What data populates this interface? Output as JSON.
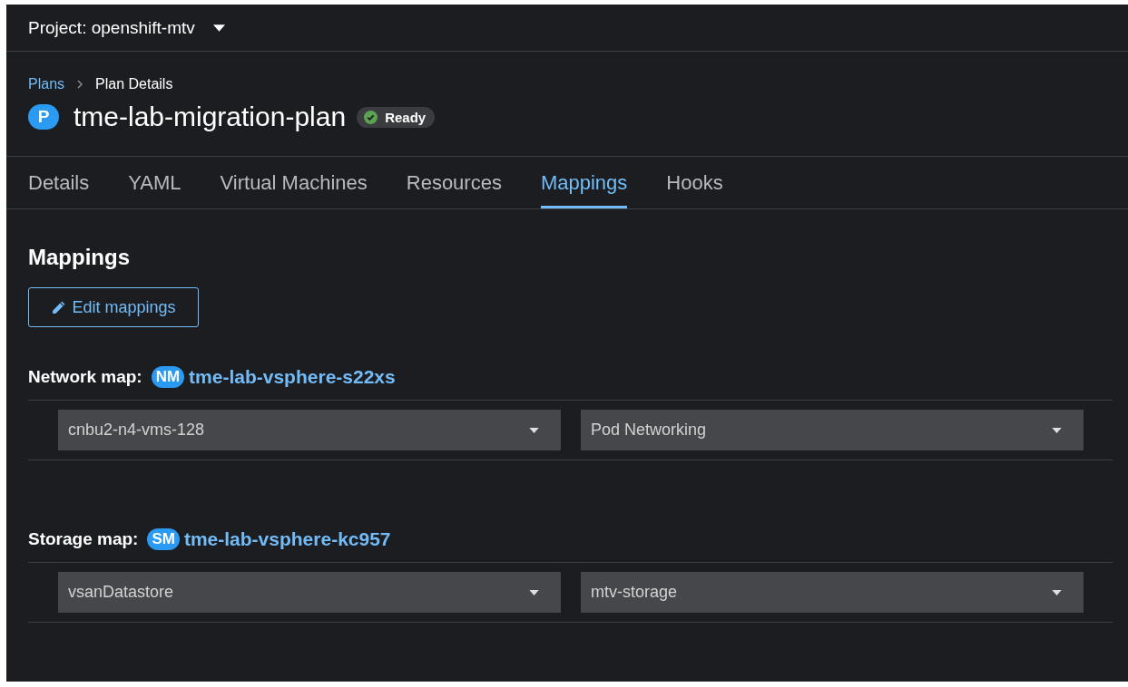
{
  "project": {
    "label": "Project: openshift-mtv"
  },
  "breadcrumb": [
    {
      "label": "Plans",
      "kind": "link"
    },
    {
      "label": "Plan Details",
      "kind": "current"
    }
  ],
  "header": {
    "badge": "P",
    "title": "tme-lab-migration-plan",
    "status": "Ready"
  },
  "tabs": [
    {
      "label": "Details",
      "selected": false
    },
    {
      "label": "YAML",
      "selected": false
    },
    {
      "label": "Virtual Machines",
      "selected": false
    },
    {
      "label": "Resources",
      "selected": false
    },
    {
      "label": "Mappings",
      "selected": true
    },
    {
      "label": "Hooks",
      "selected": false
    }
  ],
  "section": {
    "title": "Mappings",
    "edit_button": "Edit mappings"
  },
  "maps": [
    {
      "label": "Network map:",
      "badge": "NM",
      "name": "tme-lab-vsphere-s22xs",
      "rows": [
        {
          "source": "cnbu2-n4-vms-128",
          "target": "Pod Networking"
        }
      ]
    },
    {
      "label": "Storage map:",
      "badge": "SM",
      "name": "tme-lab-vsphere-kc957",
      "rows": [
        {
          "source": "vsanDatastore",
          "target": "mtv-storage"
        }
      ]
    }
  ]
}
